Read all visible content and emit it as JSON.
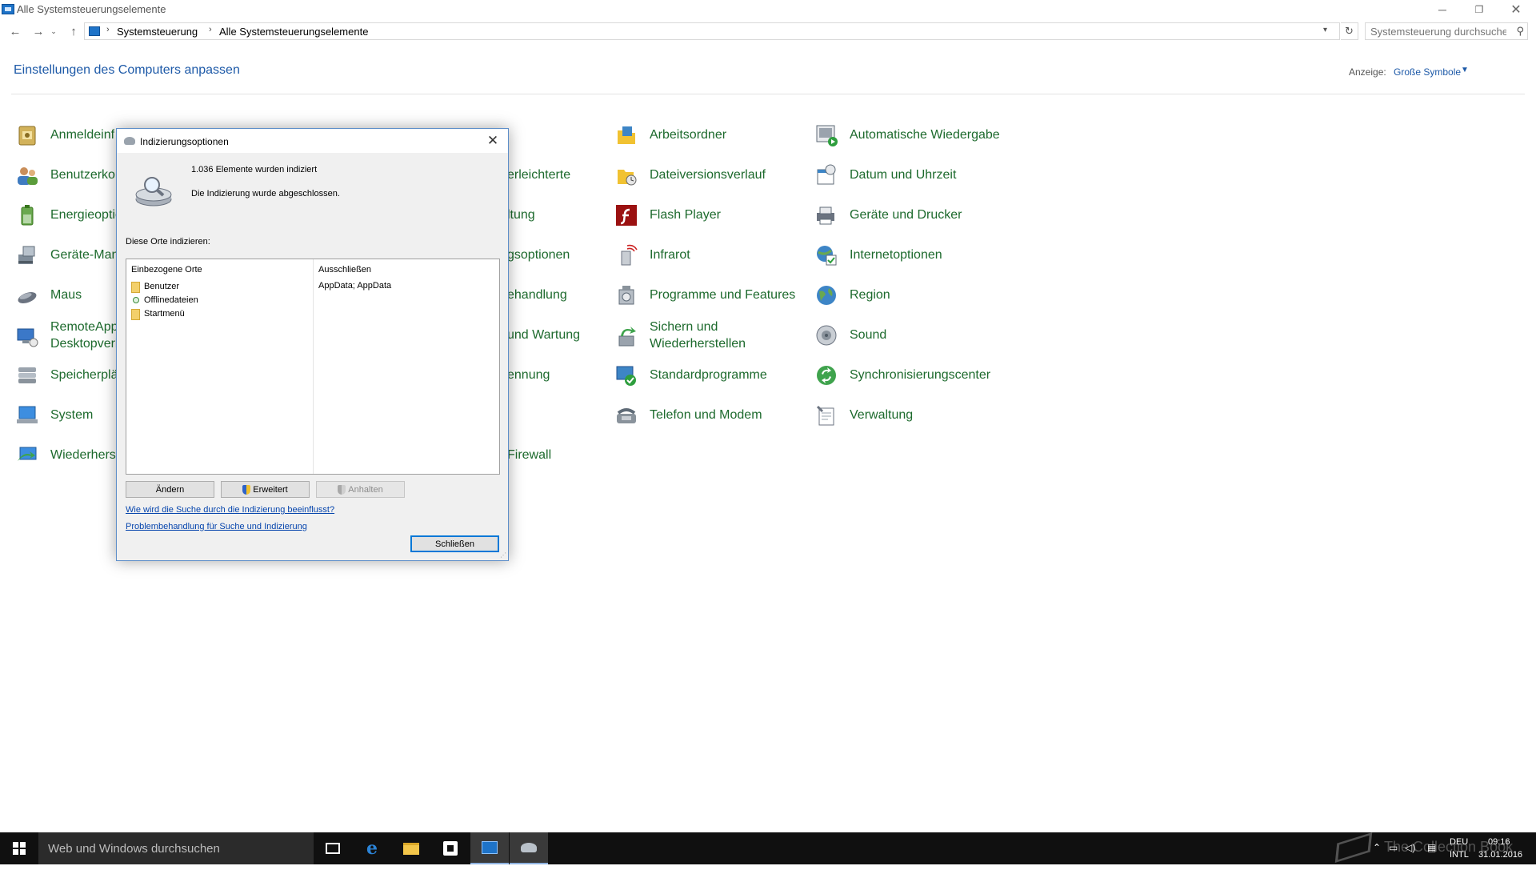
{
  "window": {
    "title": "Alle Systemsteuerungselemente",
    "minimize": "─",
    "maximize": "❐",
    "close": "✕"
  },
  "nav": {
    "back": "←",
    "forward": "→",
    "recent": "⌄",
    "up": "↑",
    "breadcrumb": [
      "Systemsteuerung",
      "Alle Systemsteuerungselemente"
    ],
    "refresh": "↻",
    "search_placeholder": "Systemsteuerung durchsuchen"
  },
  "header": {
    "title": "Einstellungen des Computers anpassen",
    "view_label": "Anzeige:",
    "view_value": "Große Symbole"
  },
  "items": {
    "col1": [
      {
        "label": "Anmeldeinf",
        "icon": "credential-manager-icon"
      },
      {
        "label": "Benutzerkon",
        "icon": "user-accounts-icon"
      },
      {
        "label": "Energieoptic",
        "icon": "power-options-icon"
      },
      {
        "label": "Geräte-Man",
        "icon": "device-manager-icon"
      },
      {
        "label": "Maus",
        "icon": "mouse-icon"
      },
      {
        "label": "RemoteApp\nDesktopverb",
        "icon": "remoteapp-icon"
      },
      {
        "label": "Speicherplä",
        "icon": "storage-spaces-icon"
      },
      {
        "label": "System",
        "icon": "system-icon"
      },
      {
        "label": "Wiederherst",
        "icon": "recovery-icon"
      }
    ],
    "col2": [
      {
        "label": "erleichterte"
      },
      {
        "label": "ltung"
      },
      {
        "label": "gsoptionen"
      },
      {
        "label": "ehandlung"
      },
      {
        "label": "und Wartung"
      },
      {
        "label": "ennung"
      },
      {
        "label": "Firewall"
      }
    ],
    "col3": [
      {
        "label": "Arbeitsordner",
        "icon": "work-folders-icon"
      },
      {
        "label": "Dateiversionsverlauf",
        "icon": "file-history-icon"
      },
      {
        "label": "Flash Player",
        "icon": "flash-player-icon"
      },
      {
        "label": "Infrarot",
        "icon": "infrared-icon"
      },
      {
        "label": "Programme und Features",
        "icon": "programs-features-icon"
      },
      {
        "label": "Sichern und\nWiederherstellen",
        "icon": "backup-restore-icon"
      },
      {
        "label": "Standardprogramme",
        "icon": "default-programs-icon"
      },
      {
        "label": "Telefon und Modem",
        "icon": "phone-modem-icon"
      }
    ],
    "col4": [
      {
        "label": "Automatische Wiedergabe",
        "icon": "autoplay-icon"
      },
      {
        "label": "Datum und Uhrzeit",
        "icon": "date-time-icon"
      },
      {
        "label": "Geräte und Drucker",
        "icon": "devices-printers-icon"
      },
      {
        "label": "Internetoptionen",
        "icon": "internet-options-icon"
      },
      {
        "label": "Region",
        "icon": "region-icon"
      },
      {
        "label": "Sound",
        "icon": "sound-icon"
      },
      {
        "label": "Synchronisierungscenter",
        "icon": "sync-center-icon"
      },
      {
        "label": "Verwaltung",
        "icon": "administrative-tools-icon"
      }
    ]
  },
  "dialog": {
    "title": "Indizierungsoptionen",
    "close": "✕",
    "count_text": "1.036 Elemente wurden indiziert",
    "status_text": "Die Indizierung wurde abgeschlossen.",
    "section_label": "Diese Orte indizieren:",
    "header_included": "Einbezogene Orte",
    "header_excluded": "Ausschließen",
    "included": [
      "Benutzer",
      "Offlinedateien",
      "Startmenü"
    ],
    "excluded": "AppData; AppData",
    "btn_change": "Ändern",
    "btn_advanced": "Erweitert",
    "btn_pause": "Anhalten",
    "link_search": "Wie wird die Suche durch die Indizierung beeinflusst?",
    "link_troubleshoot": "Problembehandlung für Suche und Indizierung",
    "btn_close": "Schließen"
  },
  "taskbar": {
    "search_text": "Web und Windows durchsuchen",
    "lang_top": "DEU",
    "lang_bottom": "INTL",
    "time": "09:16",
    "date": "31.01.2016",
    "watermark": "The Collection Book"
  }
}
